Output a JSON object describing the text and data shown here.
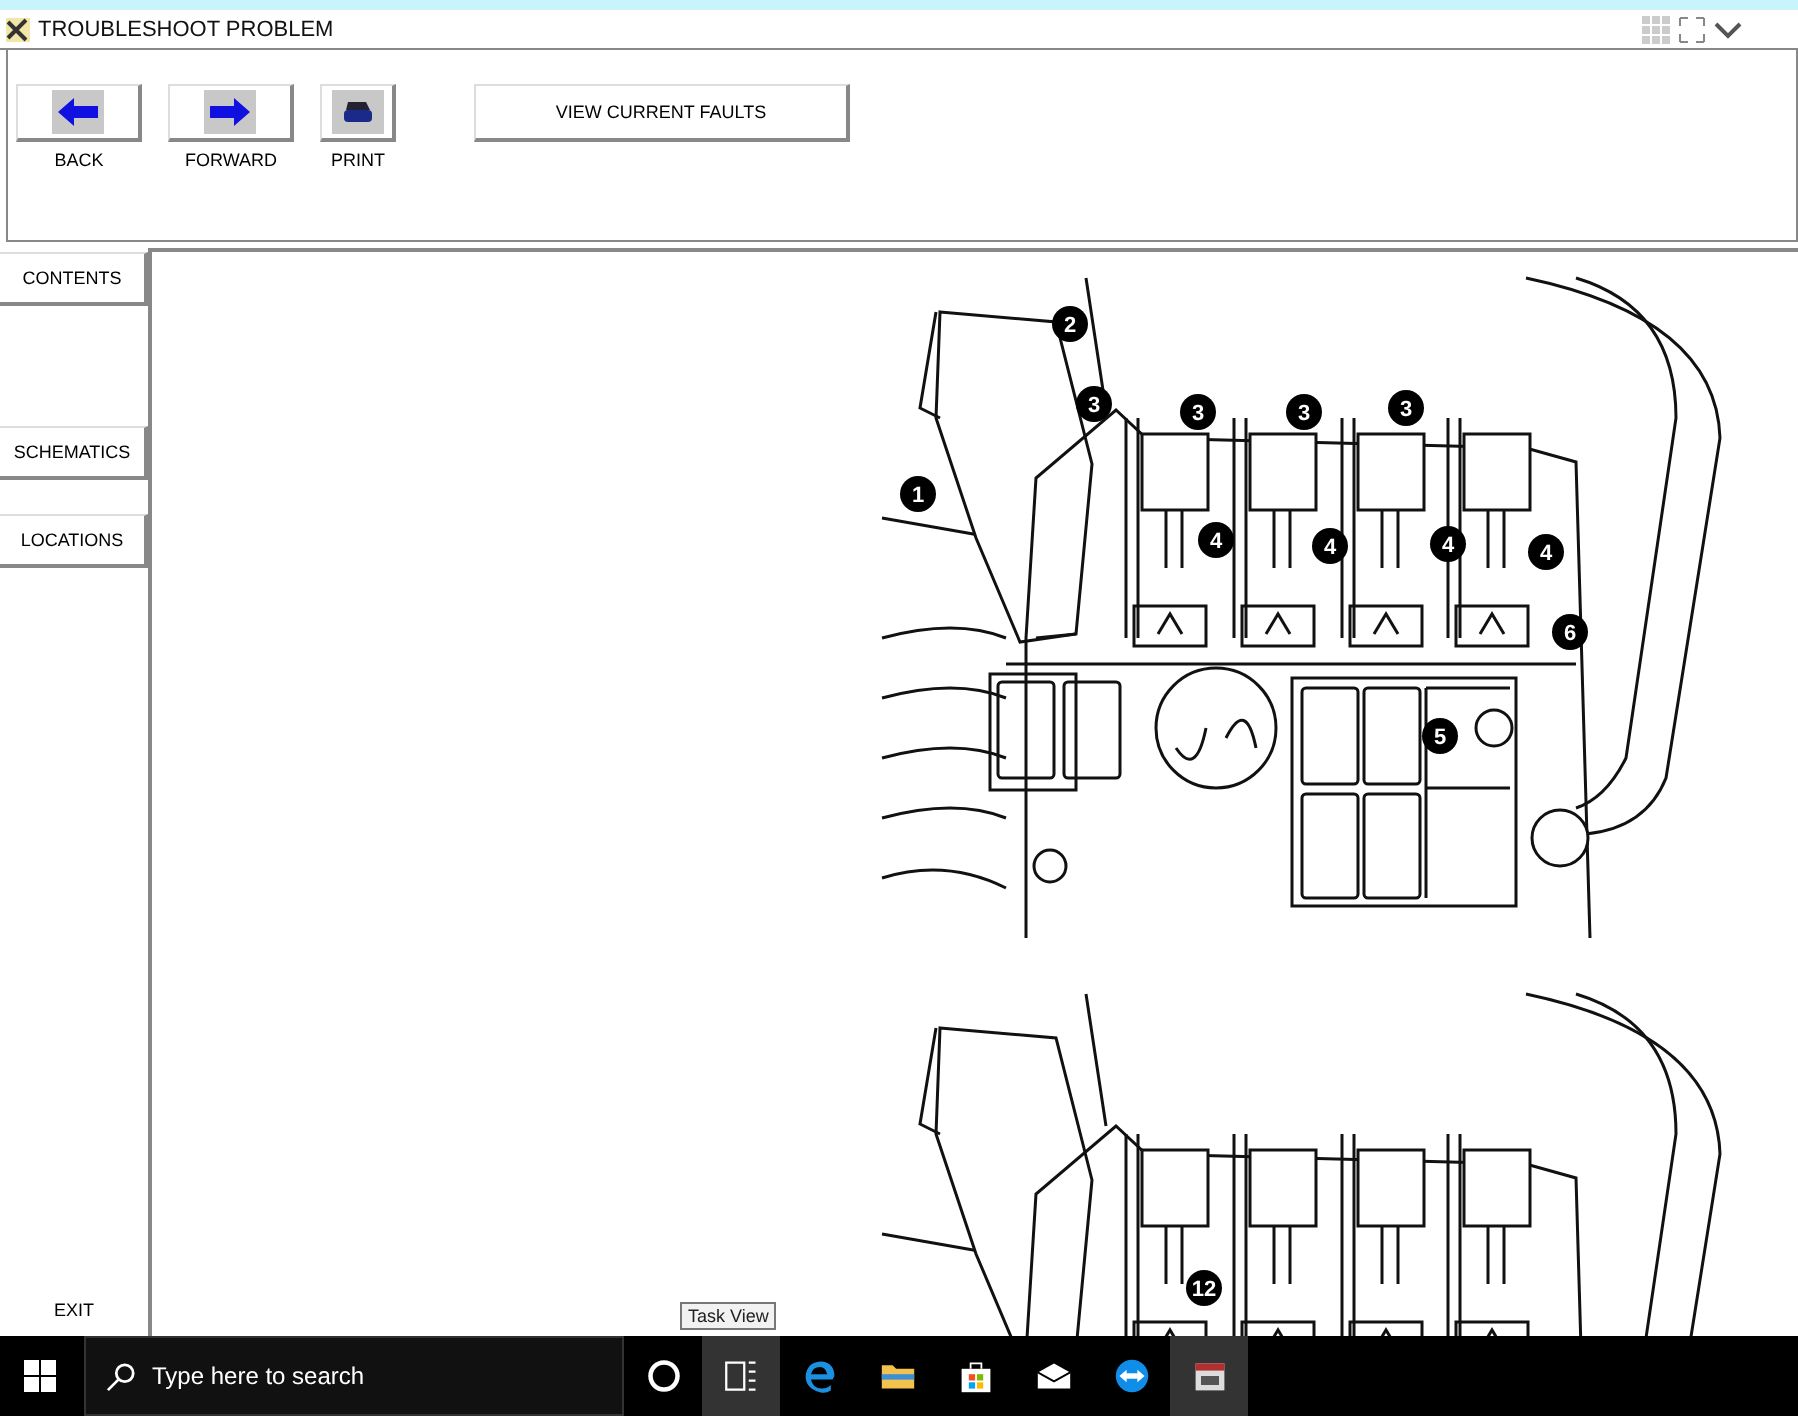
{
  "window": {
    "title": "TROUBLESHOOT PROBLEM"
  },
  "toolbar": {
    "buttons": [
      {
        "label": "BACK",
        "kind": "back"
      },
      {
        "label": "FORWARD",
        "kind": "forward"
      },
      {
        "label": "PRINT",
        "kind": "print"
      }
    ],
    "wide_button": "VIEW CURRENT FAULTS"
  },
  "sidebar": {
    "items": [
      {
        "label": "CONTENTS"
      },
      {
        "label": "SCHEMATICS"
      },
      {
        "label": "LOCATIONS"
      }
    ],
    "exit": "EXIT"
  },
  "figures": [
    {
      "callouts": [
        "1",
        "2",
        "3",
        "3",
        "3",
        "3",
        "4",
        "4",
        "4",
        "4",
        "5",
        "6"
      ]
    },
    {
      "callouts": [
        "12"
      ]
    }
  ],
  "taskbar": {
    "search_placeholder": "Type here to search",
    "tooltip": "Task View"
  }
}
